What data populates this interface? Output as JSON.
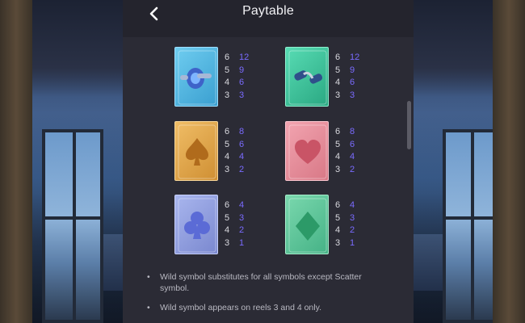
{
  "header": {
    "title": "Paytable",
    "back_icon": "chevron-left-icon"
  },
  "paytable": [
    [
      {
        "symbol": "wheel-icon",
        "color": "#47b3e0",
        "pays": [
          {
            "count": "6",
            "value": "12"
          },
          {
            "count": "5",
            "value": "9"
          },
          {
            "count": "4",
            "value": "6"
          },
          {
            "count": "3",
            "value": "3"
          }
        ]
      },
      {
        "symbol": "hand-grip-icon",
        "color": "#3fc79e",
        "pays": [
          {
            "count": "6",
            "value": "12"
          },
          {
            "count": "5",
            "value": "9"
          },
          {
            "count": "4",
            "value": "6"
          },
          {
            "count": "3",
            "value": "3"
          }
        ]
      }
    ],
    [
      {
        "symbol": "spade-icon",
        "color": "#e2a54a",
        "pays": [
          {
            "count": "6",
            "value": "8"
          },
          {
            "count": "5",
            "value": "6"
          },
          {
            "count": "4",
            "value": "4"
          },
          {
            "count": "3",
            "value": "2"
          }
        ]
      },
      {
        "symbol": "heart-icon",
        "color": "#e28a98",
        "pays": [
          {
            "count": "6",
            "value": "8"
          },
          {
            "count": "5",
            "value": "6"
          },
          {
            "count": "4",
            "value": "4"
          },
          {
            "count": "3",
            "value": "2"
          }
        ]
      }
    ],
    [
      {
        "symbol": "club-icon",
        "color": "#8e9ee0",
        "pays": [
          {
            "count": "6",
            "value": "4"
          },
          {
            "count": "5",
            "value": "3"
          },
          {
            "count": "4",
            "value": "2"
          },
          {
            "count": "3",
            "value": "1"
          }
        ]
      },
      {
        "symbol": "diamond-icon",
        "color": "#57c49a",
        "pays": [
          {
            "count": "6",
            "value": "4"
          },
          {
            "count": "5",
            "value": "3"
          },
          {
            "count": "4",
            "value": "2"
          },
          {
            "count": "3",
            "value": "1"
          }
        ]
      }
    ]
  ],
  "rules": [
    "Wild symbol substitutes for all symbols except Scatter symbol.",
    "Wild symbol appears on reels 3 and 4 only."
  ],
  "colors": {
    "panel": "#2b2b35",
    "header": "#24242d",
    "pay_value": "#7a6bff"
  }
}
